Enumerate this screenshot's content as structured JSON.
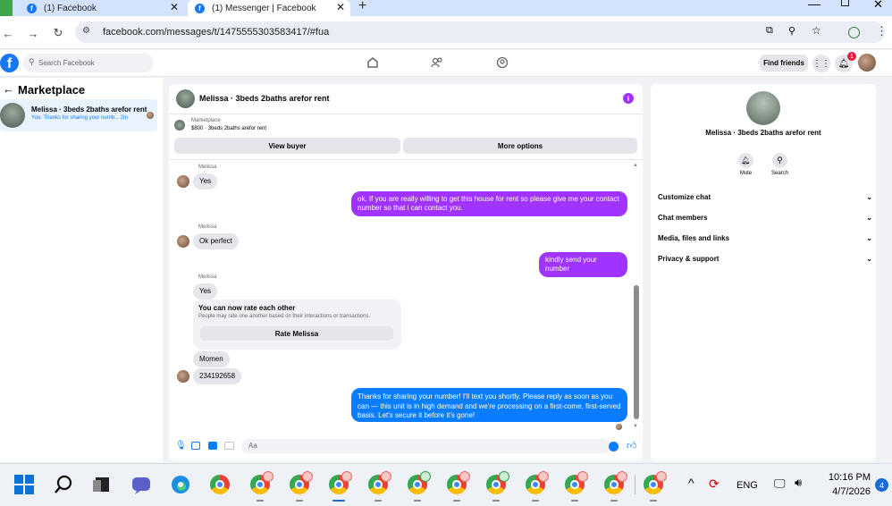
{
  "browser": {
    "tabs": [
      {
        "title": "(1) Facebook"
      },
      {
        "title": "(1) Messenger | Facebook"
      }
    ],
    "url": "facebook.com/messages/t/1475555303583417/#fua"
  },
  "fb": {
    "search_placeholder": "Search Facebook",
    "find_friends": "Find friends",
    "notif_count": "1"
  },
  "left": {
    "title": "Marketplace",
    "thread_name": "Melissa · 3beds 2baths arefor rent",
    "thread_preview": "You: Thanks for sharing your numb... 2m"
  },
  "chat": {
    "header_name": "Melissa · 3beds 2baths arefor rent",
    "listing_label": "Marketplace",
    "listing_detail": "$800 · 3beds 2baths arefor rent",
    "view_buyer": "View buyer",
    "more_options": "More options",
    "messages": {
      "m1_sender": "Melissa",
      "m1_text": "Yes",
      "m2_text": "ok, If you are really willing to get this house for rent so please give me your contact number so that i can contact you.",
      "m3_sender": "Melissa",
      "m3_text": "Ok perfect",
      "m4_text": "kindly send your number",
      "m5_sender": "Melissa",
      "m5_text": "Yes",
      "rate_title": "You can now rate each other",
      "rate_sub": "People may rate one another based on their interactions or transactions.",
      "rate_button": "Rate Melissa",
      "m6_text": "Momen",
      "m7_text": "234192658",
      "m8_text": "Thanks for sharing your number! I'll text you shortly. Please reply as soon as you can — this unit is in high demand and we're processing on a first-come, first-served basis. Let's secure it before it's gone!"
    },
    "composer_placeholder": "Aa"
  },
  "right": {
    "name": "Melissa · 3beds 2baths arefor rent",
    "mute": "Mute",
    "search": "Search",
    "sections": [
      "Customize chat",
      "Chat members",
      "Media, files and links",
      "Privacy & support"
    ]
  },
  "taskbar": {
    "lang": "ENG",
    "time": "10:16 PM",
    "date": "4/7/2026",
    "badge": "4"
  },
  "colors": {
    "fb_blue": "#1877f2",
    "purple_bubble": "#a033ff",
    "blue_bubble": "#0a7cff",
    "info_purple": "#a033ff"
  }
}
